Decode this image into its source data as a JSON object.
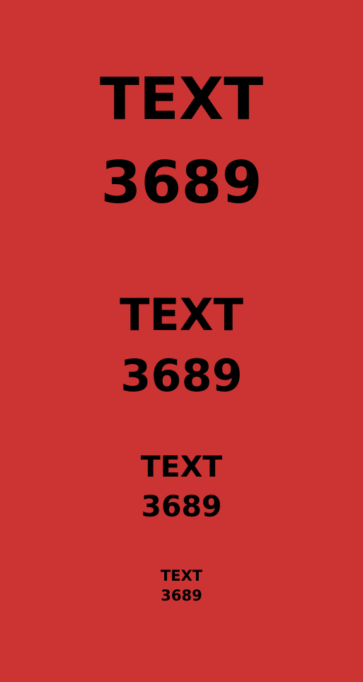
{
  "background_color": "#cc3333",
  "text_color": "#000000",
  "groups": [
    {
      "word": "TEXT",
      "number": "3689"
    },
    {
      "word": "TEXT",
      "number": "3689"
    },
    {
      "word": "TEXT",
      "number": "3689"
    },
    {
      "word": "TEXT",
      "number": "3689"
    }
  ]
}
